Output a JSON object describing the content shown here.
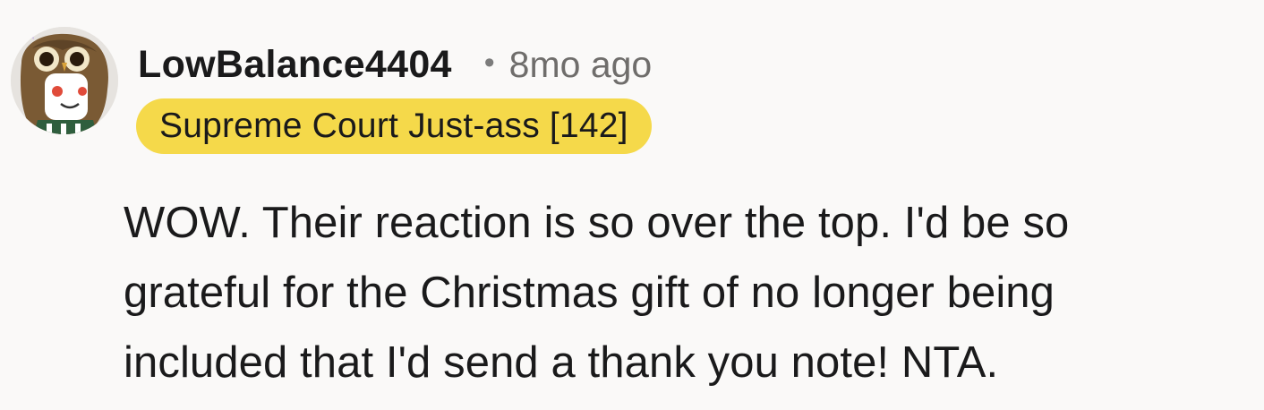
{
  "comment": {
    "author": {
      "username": "LowBalance4404",
      "avatar_icon": "owl-costume-avatar-icon"
    },
    "separator": "•",
    "timestamp": "8mo ago",
    "flair": {
      "text": "Supreme Court Just-ass [142]",
      "color": "#f5d94a"
    },
    "body_lines": [
      "WOW. Their reaction is so over the top. I'd be so",
      "grateful for the Christmas gift of no longer being",
      "included that I'd send a thank you note! NTA."
    ]
  }
}
